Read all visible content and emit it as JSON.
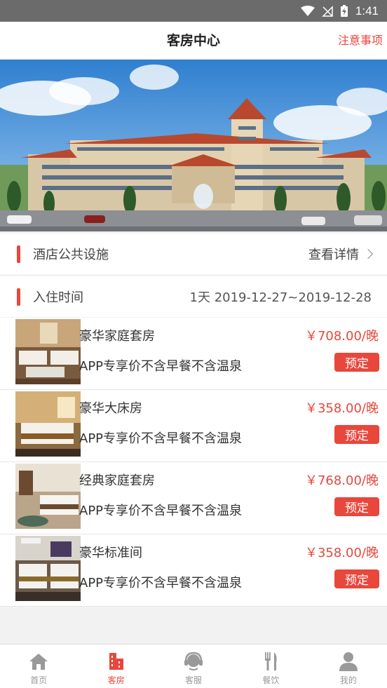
{
  "status_bar": {
    "time": "1:41"
  },
  "header": {
    "title": "客房中心",
    "notice": "注意事项"
  },
  "facilities": {
    "label": "酒店公共设施",
    "link": "查看详情"
  },
  "checkin": {
    "label": "入住时间",
    "value": "1天 2019-12-27~2019-12-28"
  },
  "rooms": [
    {
      "name": "豪华家庭套房",
      "price": "￥708.00/晚",
      "desc": "APP专享价不含早餐不含温泉",
      "button": "预定"
    },
    {
      "name": "豪华大床房",
      "price": "￥358.00/晚",
      "desc": "APP专享价不含早餐不含温泉",
      "button": "预定"
    },
    {
      "name": "经典家庭套房",
      "price": "￥768.00/晚",
      "desc": "APP专享价不含早餐不含温泉",
      "button": "预定"
    },
    {
      "name": "豪华标准间",
      "price": "￥358.00/晚",
      "desc": "APP专享价不含早餐不含温泉",
      "button": "预定"
    }
  ],
  "tabbar": [
    {
      "label": "首页",
      "icon": "home-icon"
    },
    {
      "label": "客房",
      "icon": "building-icon",
      "active": true
    },
    {
      "label": "客服",
      "icon": "headset-icon"
    },
    {
      "label": "餐饮",
      "icon": "fork-knife-icon"
    },
    {
      "label": "我的",
      "icon": "user-icon"
    }
  ],
  "colors": {
    "accent": "#e8473c",
    "status_bar": "#6b6b6b",
    "inactive_tab": "#999999"
  }
}
